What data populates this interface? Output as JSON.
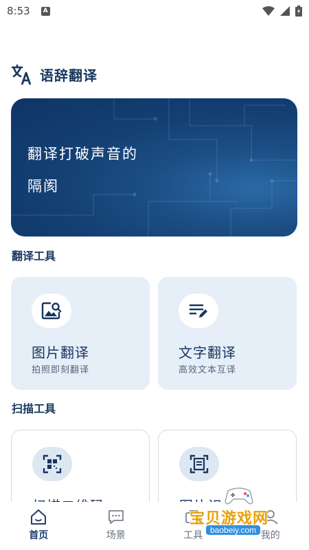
{
  "status_bar": {
    "time": "8:53",
    "notification_letter": "A"
  },
  "app": {
    "title": "语辞翻译"
  },
  "hero": {
    "line1": "翻译打破声音的",
    "line2": "隔阂"
  },
  "sections": {
    "translate_tools": {
      "title": "翻译工具",
      "cards": [
        {
          "name": "图片翻译",
          "desc": "拍照即刻翻译",
          "icon": "image-search-icon"
        },
        {
          "name": "文字翻译",
          "desc": "高效文本互译",
          "icon": "text-edit-icon"
        }
      ]
    },
    "scan_tools": {
      "title": "扫描工具",
      "cards": [
        {
          "name": "扫描二维码",
          "icon": "qr-scan-icon"
        },
        {
          "name": "图片识",
          "icon": "document-scan-icon"
        }
      ]
    }
  },
  "nav": {
    "items": [
      {
        "label": "首页",
        "icon": "home-icon",
        "active": true
      },
      {
        "label": "场景",
        "icon": "chat-icon",
        "active": false
      },
      {
        "label": "工具",
        "icon": "tools-icon",
        "active": false
      },
      {
        "label": "我的",
        "icon": "profile-icon",
        "active": false
      }
    ]
  },
  "watermark": {
    "text": "宝贝游戏网",
    "url": "baobeiy.com"
  },
  "colors": {
    "primary": "#17365e",
    "hero_bg": "#133f73",
    "card_bg": "#e6eef8",
    "watermark": "#e8a10a"
  }
}
